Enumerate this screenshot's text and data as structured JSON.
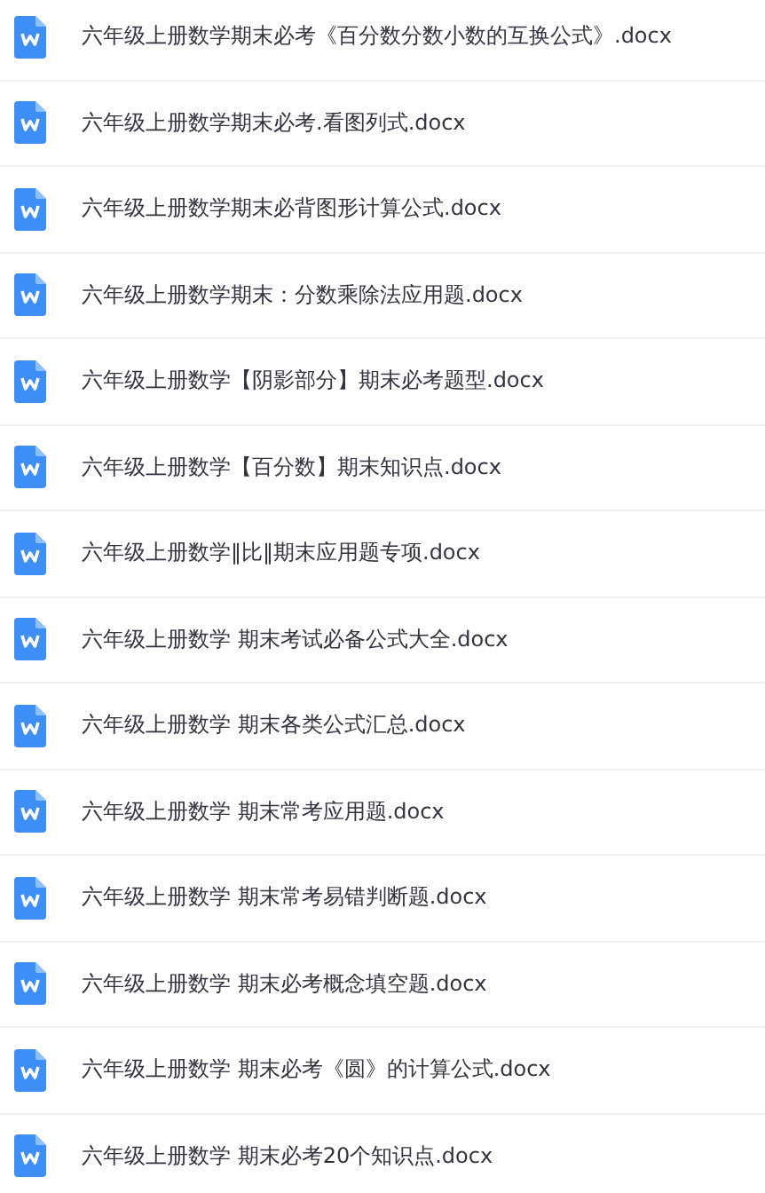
{
  "files": [
    {
      "name": "六年级上册数学期末必考《百分数分数小数的互换公式》.docx"
    },
    {
      "name": "六年级上册数学期末必考.看图列式.docx"
    },
    {
      "name": "六年级上册数学期末必背图形计算公式.docx"
    },
    {
      "name": "六年级上册数学期末：分数乘除法应用题.docx"
    },
    {
      "name": "六年级上册数学【阴影部分】期末必考题型.docx"
    },
    {
      "name": "六年级上册数学【百分数】期末知识点.docx"
    },
    {
      "name": "六年级上册数学‖比‖期末应用题专项.docx"
    },
    {
      "name": "六年级上册数学 期末考试必备公式大全.docx"
    },
    {
      "name": "六年级上册数学 期末各类公式汇总.docx"
    },
    {
      "name": "六年级上册数学 期末常考应用题.docx"
    },
    {
      "name": "六年级上册数学 期末常考易错判断题.docx"
    },
    {
      "name": "六年级上册数学 期末必考概念填空题.docx"
    },
    {
      "name": "六年级上册数学 期末必考《圆》的计算公式.docx"
    },
    {
      "name": "六年级上册数学 期末必考20个知识点.docx"
    }
  ]
}
